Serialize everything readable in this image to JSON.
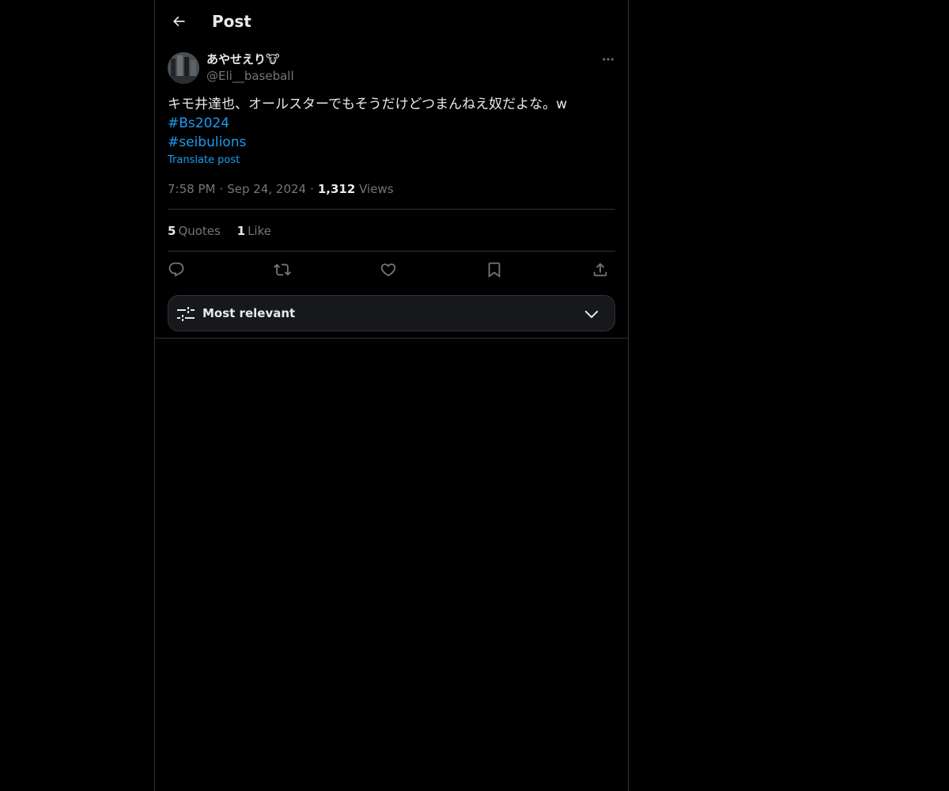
{
  "header": {
    "title": "Post"
  },
  "author": {
    "display_name": "あやせえり🐮",
    "handle": "@Eli__baseball"
  },
  "tweet": {
    "text_line": "キモ井達也、オールスターでもそうだけどつまんねえ奴だよな。w",
    "hashtags": [
      "#Bs2024",
      "#seibulions"
    ],
    "translate_label": "Translate post",
    "time": "7:58 PM",
    "date": "Sep 24, 2024",
    "separator": "·",
    "views_count": "1,312",
    "views_label": "Views"
  },
  "stats": {
    "quotes_count": "5",
    "quotes_label": "Quotes",
    "likes_count": "1",
    "likes_label": "Like"
  },
  "actions": [
    "reply-icon",
    "repost-icon",
    "like-icon",
    "bookmark-icon",
    "share-icon"
  ],
  "sort": {
    "label": "Most relevant"
  },
  "colors": {
    "background": "#000000",
    "text": "#e7e9ea",
    "muted": "#71767b",
    "accent": "#1d9bf0",
    "border": "#2f3336"
  }
}
